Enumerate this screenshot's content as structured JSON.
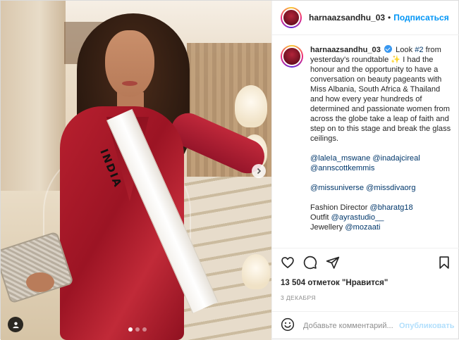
{
  "media": {
    "sash_text": "INDIA",
    "carousel_count": 3,
    "carousel_active": 1
  },
  "header": {
    "username": "harnaazsandhu_03",
    "separator": "•",
    "follow_label": "Подписаться"
  },
  "caption": {
    "username": "harnaazsandhu_03",
    "text_before_hashtag": "Look ",
    "hashtag": "#2",
    "text_after_hashtag": " from yesterday's roundtable ✨ I had the honour and the opportunity to have a conversation on beauty pageants with Miss Albania, South Africa & Thailand and how every year hundreds of determined and passionate women from across the globe take a leap of faith and step on to this stage and break the glass ceilings.",
    "mentions_line1": [
      "@laleIa_mswane",
      "@inadajcireal"
    ],
    "mentions_line2": "@annscottkemmis",
    "mentions_line3": [
      "@missuniverse",
      "@missdivaorg"
    ],
    "credits": [
      {
        "label": "Fashion Director ",
        "handle": "@bharatg18"
      },
      {
        "label": "Outfit ",
        "handle": "@ayrastudio__"
      },
      {
        "label": "Jewellery ",
        "handle": "@mozaati"
      }
    ]
  },
  "actions": {
    "icons": [
      "heart-icon",
      "comment-icon",
      "share-icon",
      "bookmark-icon"
    ]
  },
  "likes_text": "13 504 отметок \"Нравится\"",
  "date_text": "3 ДЕКАБРЯ",
  "comment": {
    "placeholder": "Добавьте комментарий...",
    "post_label": "Опубликовать"
  },
  "colors": {
    "link_blue": "#0095f6",
    "tag_blue": "#00376b",
    "post_disabled": "#b2dffc",
    "muted": "#8e8e8e"
  }
}
